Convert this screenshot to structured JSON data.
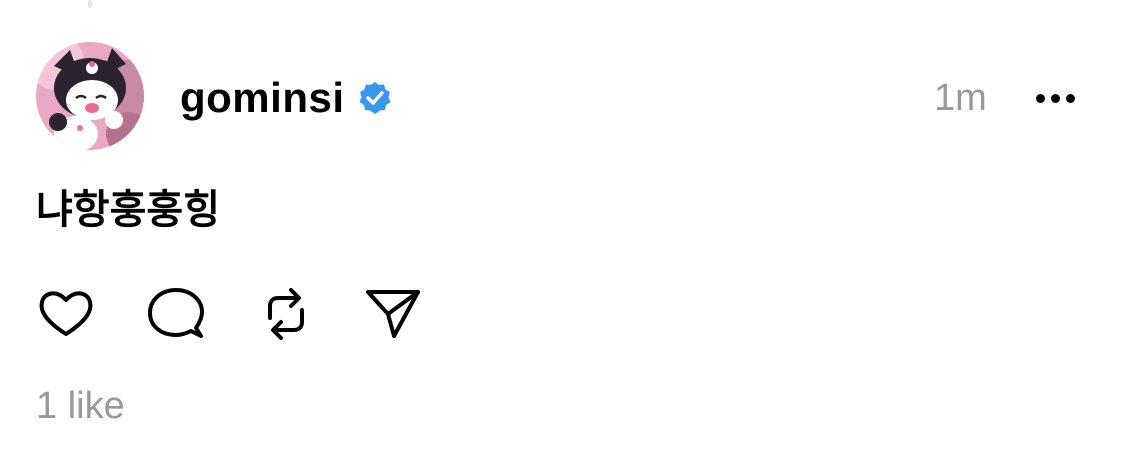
{
  "post": {
    "author": {
      "username": "gominsi",
      "verified": true,
      "avatar_icon": "avatar-kuromi-character"
    },
    "timestamp": "1m",
    "more_icon": "more-horizontal-icon",
    "text": "냐항훙훙힝",
    "actions": [
      {
        "name": "like",
        "icon": "heart-icon"
      },
      {
        "name": "reply",
        "icon": "comment-bubble-icon"
      },
      {
        "name": "repost",
        "icon": "repost-arrows-icon"
      },
      {
        "name": "share",
        "icon": "send-icon"
      }
    ],
    "likes_label": "1 like"
  },
  "colors": {
    "text": "#000000",
    "muted": "#999999",
    "verified_blue": "#3897f0",
    "avatar_pink": "#e9a9c4"
  }
}
